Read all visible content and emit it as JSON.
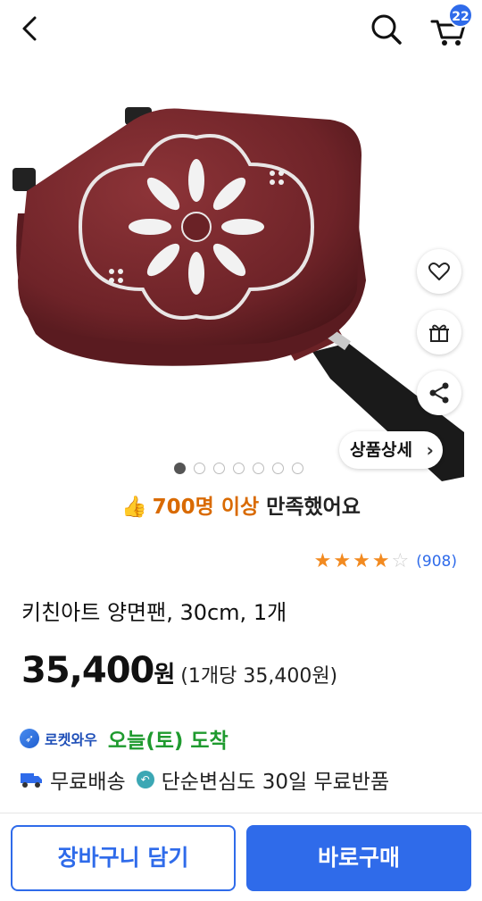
{
  "header": {
    "cart_count": "22"
  },
  "icons": {
    "back": "chevron-left-icon",
    "search": "search-icon",
    "cart": "cart-icon",
    "wishlist": "heart-icon",
    "gift": "gift-icon",
    "share": "share-icon"
  },
  "product_image": {
    "dots_total": 7,
    "active_dot": 1,
    "detail_label": "상품상세"
  },
  "satisfaction": {
    "count": "700명 이상",
    "suffix": "만족했어요"
  },
  "rating": {
    "stars_filled": 4,
    "stars_total": 5,
    "review_count": "(908)"
  },
  "product": {
    "title": "키친아트 양면팬, 30cm, 1개",
    "price": "35,400",
    "currency": "원",
    "unit_price": "(1개당 35,400원)"
  },
  "delivery": {
    "badge": "로켓와우",
    "arrival": "오늘(토) 도착",
    "free_shipping": "무료배송",
    "free_return": "단순변심도 30일 무료반품"
  },
  "actions": {
    "add_to_cart": "장바구니 담기",
    "buy_now": "바로구매"
  },
  "colors": {
    "accent": "#2f6bea",
    "arrival_green": "#1e9a2e",
    "satisfaction_orange": "#d96a00",
    "star": "#f28a20",
    "pan_body": "#7a2a2e"
  }
}
